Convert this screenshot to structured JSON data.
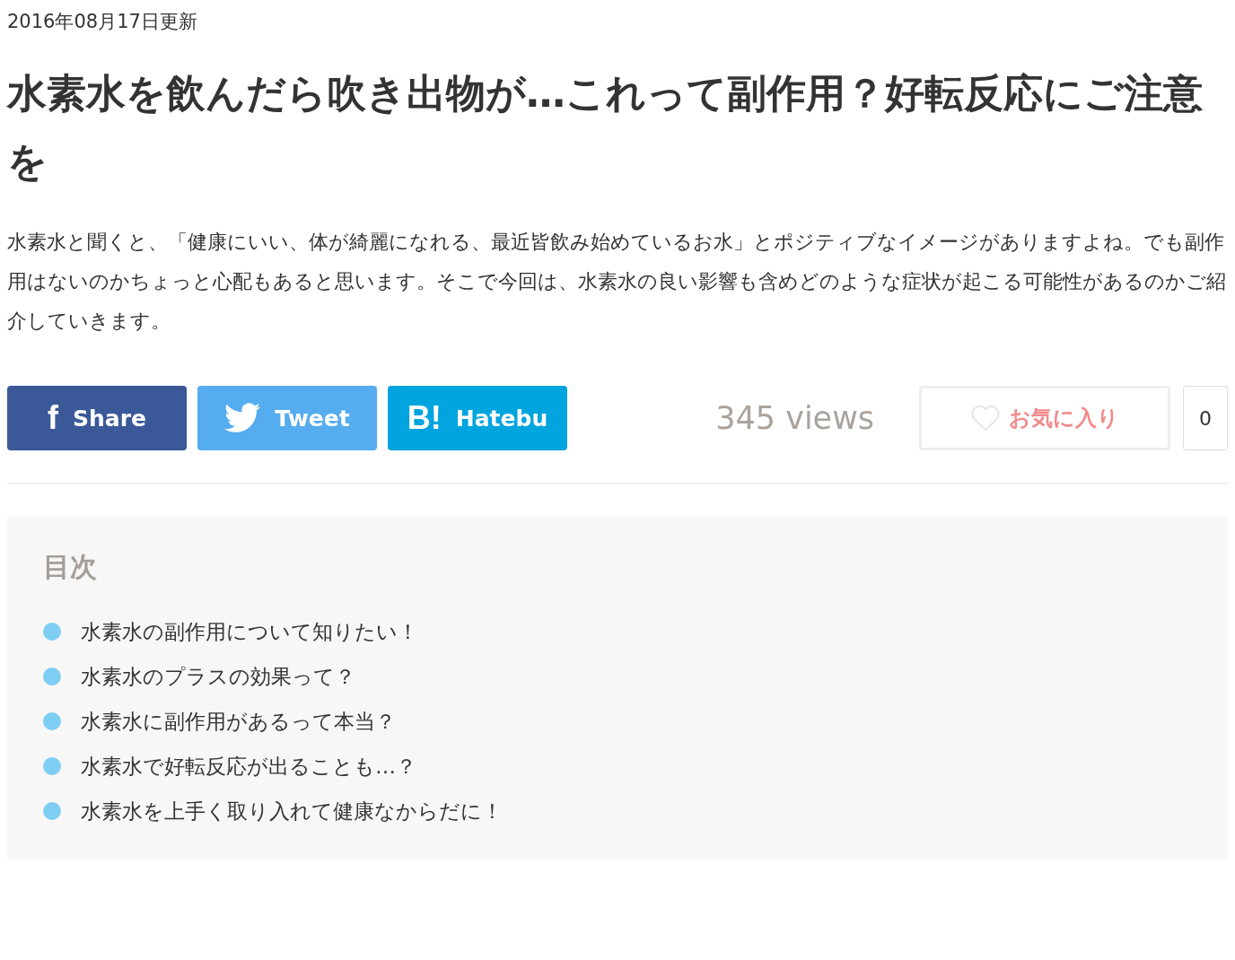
{
  "date": "2016年08月17日更新",
  "title": "水素水を飲んだら吹き出物が…これって副作用？好転反応にご注意を",
  "description": "水素水と聞くと、「健康にいい、体が綺麗になれる、最近皆飲み始めているお水」とポジティブなイメージがありますよね。でも副作用はないのかちょっと心配もあると思います。そこで今回は、水素水の良い影響も含めどのような症状が起こる可能性があるのかご紹介していきます。",
  "share_buttons": [
    {
      "kind": "facebook",
      "icon_text": "f",
      "label": "Share"
    },
    {
      "kind": "twitter",
      "label": "Tweet"
    },
    {
      "kind": "hatebu",
      "icon_text": "B!",
      "label": "Hatebu"
    }
  ],
  "views": "345 views",
  "favorite": {
    "label": "お気に入り",
    "count": "0"
  },
  "toc": {
    "heading": "目次",
    "items": [
      {
        "text": "水素水の副作用について知りたい！"
      },
      {
        "text": "水素水のプラスの効果って？"
      },
      {
        "text": "水素水に副作用があるって本当？"
      },
      {
        "text": "水素水で好転反応が出ることも…？"
      },
      {
        "text": "水素水を上手く取り入れて健康なからだに！"
      }
    ]
  }
}
